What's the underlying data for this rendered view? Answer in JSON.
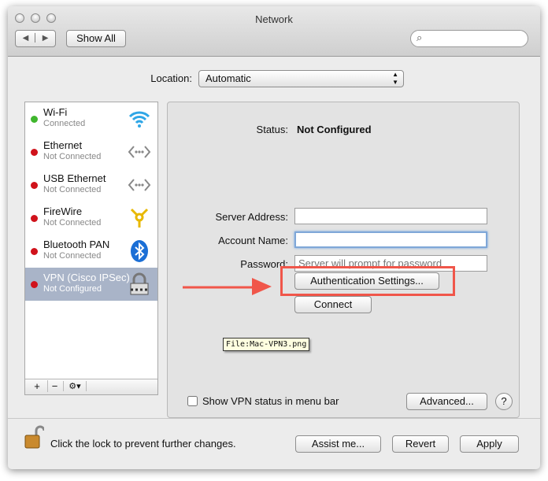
{
  "window": {
    "title": "Network"
  },
  "toolbar": {
    "show_all": "Show All",
    "search_placeholder": ""
  },
  "location": {
    "label": "Location:",
    "value": "Automatic"
  },
  "services": [
    {
      "name": "Wi-Fi",
      "status": "Connected",
      "dot": "#3fb62d",
      "icon": "wifi-icon"
    },
    {
      "name": "Ethernet",
      "status": "Not Connected",
      "dot": "#d0121b",
      "icon": "ethernet-icon"
    },
    {
      "name": "USB Ethernet",
      "status": "Not Connected",
      "dot": "#d0121b",
      "icon": "ethernet-icon"
    },
    {
      "name": "FireWire",
      "status": "Not Connected",
      "dot": "#d0121b",
      "icon": "firewire-icon"
    },
    {
      "name": "Bluetooth PAN",
      "status": "Not Connected",
      "dot": "#d0121b",
      "icon": "bluetooth-icon"
    },
    {
      "name": "VPN (Cisco IPSec)",
      "status": "Not Configured",
      "dot": "#d0121b",
      "icon": "lock-icon",
      "selected": true
    }
  ],
  "list_controls": {
    "add": "+",
    "remove": "−",
    "gear": "⚙▾"
  },
  "detail": {
    "status_label": "Status:",
    "status_value": "Not Configured",
    "server_label": "Server Address:",
    "server_value": "",
    "account_label": "Account Name:",
    "account_value": "",
    "password_label": "Password:",
    "password_placeholder": "Server will prompt for password",
    "auth_button": "Authentication Settings...",
    "connect_button": "Connect",
    "tooltip": "File:Mac-VPN3.png",
    "show_status_label": "Show VPN status in menu bar",
    "show_status_checked": false,
    "advanced_button": "Advanced...",
    "help_button": "?"
  },
  "annotation": {
    "color": "#f0564a"
  },
  "footer": {
    "lock_text": "Click the lock to prevent further changes.",
    "assist": "Assist me...",
    "revert": "Revert",
    "apply": "Apply"
  }
}
